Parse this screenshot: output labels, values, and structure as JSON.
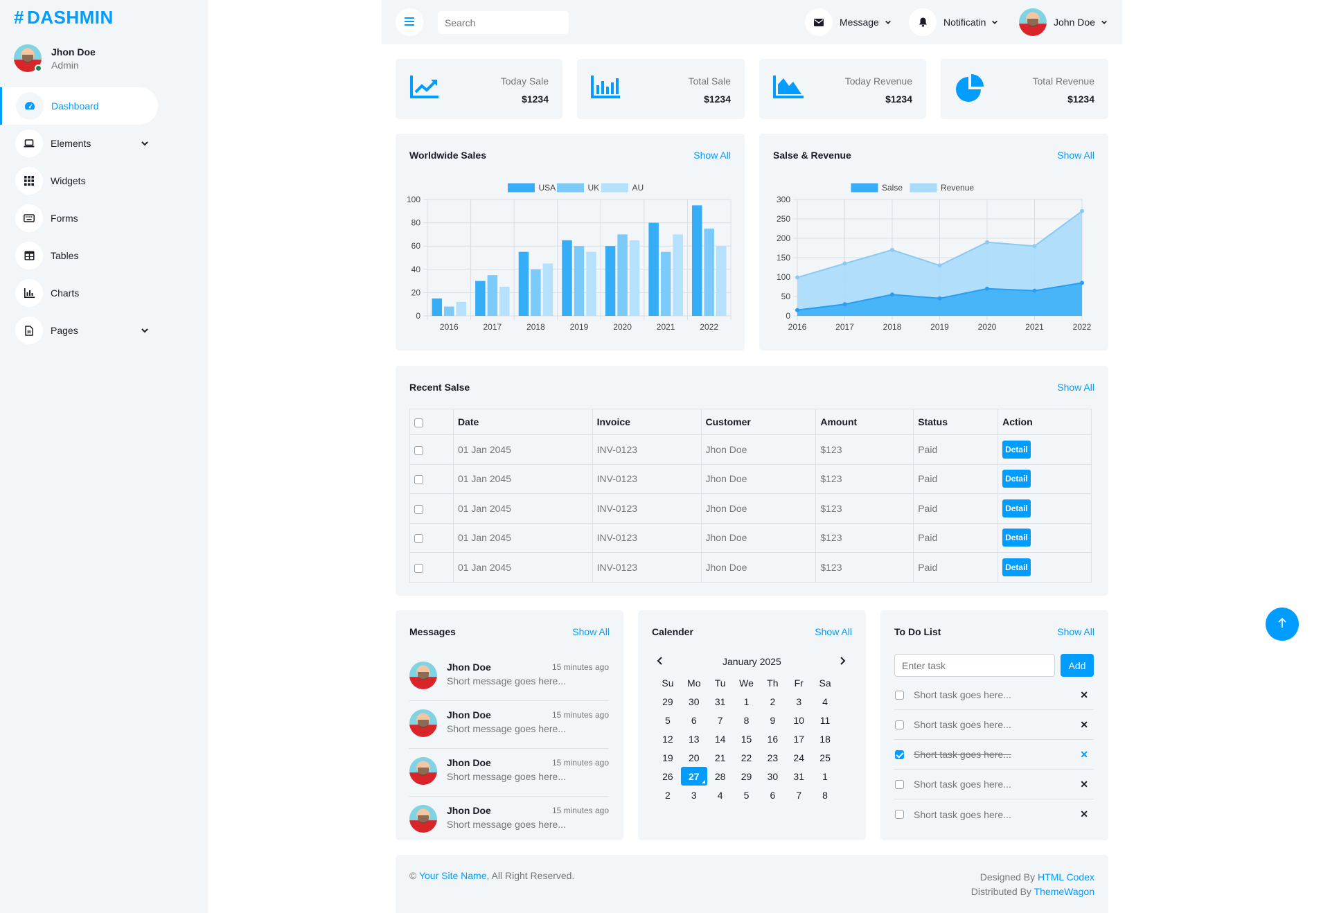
{
  "brand": {
    "hash": "#",
    "name": "DASHMIN"
  },
  "profile": {
    "name": "Jhon Doe",
    "role": "Admin"
  },
  "sidebar": {
    "items": [
      {
        "label": "Dashboard",
        "icon": "gauge-icon"
      },
      {
        "label": "Elements",
        "icon": "laptop-icon"
      },
      {
        "label": "Widgets",
        "icon": "grid-icon"
      },
      {
        "label": "Forms",
        "icon": "keyboard-icon"
      },
      {
        "label": "Tables",
        "icon": "table-icon"
      },
      {
        "label": "Charts",
        "icon": "chart-bar-icon"
      },
      {
        "label": "Pages",
        "icon": "file-icon"
      }
    ]
  },
  "topbar": {
    "search_placeholder": "Search",
    "message_label": "Message",
    "notification_label": "Notificatin",
    "user_name": "John Doe"
  },
  "stats": [
    {
      "label": "Today Sale",
      "value": "$1234",
      "icon": "chart-line-icon"
    },
    {
      "label": "Total Sale",
      "value": "$1234",
      "icon": "chart-bar-icon"
    },
    {
      "label": "Today Revenue",
      "value": "$1234",
      "icon": "chart-area-icon"
    },
    {
      "label": "Total Revenue",
      "value": "$1234",
      "icon": "chart-pie-icon"
    }
  ],
  "show_all": "Show All",
  "worldwide": {
    "title": "Worldwide Sales"
  },
  "revenue": {
    "title": "Salse & Revenue"
  },
  "chart_data": [
    {
      "type": "bar",
      "title": "Worldwide Sales",
      "categories": [
        "2016",
        "2017",
        "2018",
        "2019",
        "2020",
        "2021",
        "2022"
      ],
      "series": [
        {
          "name": "USA",
          "values": [
            15,
            30,
            55,
            65,
            60,
            80,
            95
          ],
          "color": "#35aef7"
        },
        {
          "name": "UK",
          "values": [
            8,
            35,
            40,
            60,
            70,
            55,
            75
          ],
          "color": "#7ccafa"
        },
        {
          "name": "AU",
          "values": [
            12,
            25,
            45,
            55,
            65,
            70,
            60
          ],
          "color": "#b6e1fc"
        }
      ],
      "ylim": [
        0,
        100
      ],
      "yticks": [
        "0",
        "20",
        "40",
        "60",
        "80",
        "100"
      ],
      "legend": "top",
      "grid": true
    },
    {
      "type": "area",
      "title": "Salse & Revenue",
      "categories": [
        "2016",
        "2017",
        "2018",
        "2019",
        "2020",
        "2021",
        "2022"
      ],
      "series": [
        {
          "name": "Salse",
          "values": [
            15,
            30,
            55,
            45,
            70,
            65,
            85
          ],
          "color": "#35aef7"
        },
        {
          "name": "Revenue",
          "values": [
            99,
            135,
            170,
            130,
            190,
            180,
            270
          ],
          "color": "#a9dbfb"
        }
      ],
      "ylim": [
        0,
        300
      ],
      "yticks": [
        "0",
        "50",
        "100",
        "150",
        "200",
        "250",
        "300"
      ],
      "legend": "top",
      "grid": true
    }
  ],
  "sales_table": {
    "title": "Recent Salse",
    "headers": [
      "Date",
      "Invoice",
      "Customer",
      "Amount",
      "Status",
      "Action"
    ],
    "rows": [
      {
        "date": "01 Jan 2045",
        "invoice": "INV-0123",
        "customer": "Jhon Doe",
        "amount": "$123",
        "status": "Paid",
        "action": "Detail"
      },
      {
        "date": "01 Jan 2045",
        "invoice": "INV-0123",
        "customer": "Jhon Doe",
        "amount": "$123",
        "status": "Paid",
        "action": "Detail"
      },
      {
        "date": "01 Jan 2045",
        "invoice": "INV-0123",
        "customer": "Jhon Doe",
        "amount": "$123",
        "status": "Paid",
        "action": "Detail"
      },
      {
        "date": "01 Jan 2045",
        "invoice": "INV-0123",
        "customer": "Jhon Doe",
        "amount": "$123",
        "status": "Paid",
        "action": "Detail"
      },
      {
        "date": "01 Jan 2045",
        "invoice": "INV-0123",
        "customer": "Jhon Doe",
        "amount": "$123",
        "status": "Paid",
        "action": "Detail"
      }
    ]
  },
  "messages": {
    "title": "Messages",
    "items": [
      {
        "name": "Jhon Doe",
        "time": "15 minutes ago",
        "text": "Short message goes here..."
      },
      {
        "name": "Jhon Doe",
        "time": "15 minutes ago",
        "text": "Short message goes here..."
      },
      {
        "name": "Jhon Doe",
        "time": "15 minutes ago",
        "text": "Short message goes here..."
      },
      {
        "name": "Jhon Doe",
        "time": "15 minutes ago",
        "text": "Short message goes here..."
      }
    ]
  },
  "calendar": {
    "title": "Calender",
    "month": "January 2025",
    "days_of_week": [
      "Su",
      "Mo",
      "Tu",
      "We",
      "Th",
      "Fr",
      "Sa"
    ],
    "dates": [
      "29",
      "30",
      "31",
      "1",
      "2",
      "3",
      "4",
      "5",
      "6",
      "7",
      "8",
      "9",
      "10",
      "11",
      "12",
      "13",
      "14",
      "15",
      "16",
      "17",
      "18",
      "19",
      "20",
      "21",
      "22",
      "23",
      "24",
      "25",
      "26",
      "27",
      "28",
      "29",
      "30",
      "31",
      "1",
      "2",
      "3",
      "4",
      "5",
      "6",
      "7",
      "8"
    ],
    "selected": "27"
  },
  "todo": {
    "title": "To Do List",
    "input_placeholder": "Enter task",
    "add_label": "Add",
    "items": [
      {
        "text": "Short task goes here...",
        "done": false
      },
      {
        "text": "Short task goes here...",
        "done": false
      },
      {
        "text": "Short task goes here...",
        "done": true
      },
      {
        "text": "Short task goes here...",
        "done": false
      },
      {
        "text": "Short task goes here...",
        "done": false
      }
    ]
  },
  "footer": {
    "copyright_symbol": "©",
    "site_name": "Your Site Name",
    "rights": ", All Right Reserved.",
    "designed_by": "Designed By",
    "designer": "HTML Codex",
    "distributed_by": "Distributed By",
    "distributor": "ThemeWagon"
  },
  "colors": {
    "primary": "#009cff",
    "light": "#f3f6f9",
    "dark": "#191c24",
    "muted": "#757575"
  }
}
